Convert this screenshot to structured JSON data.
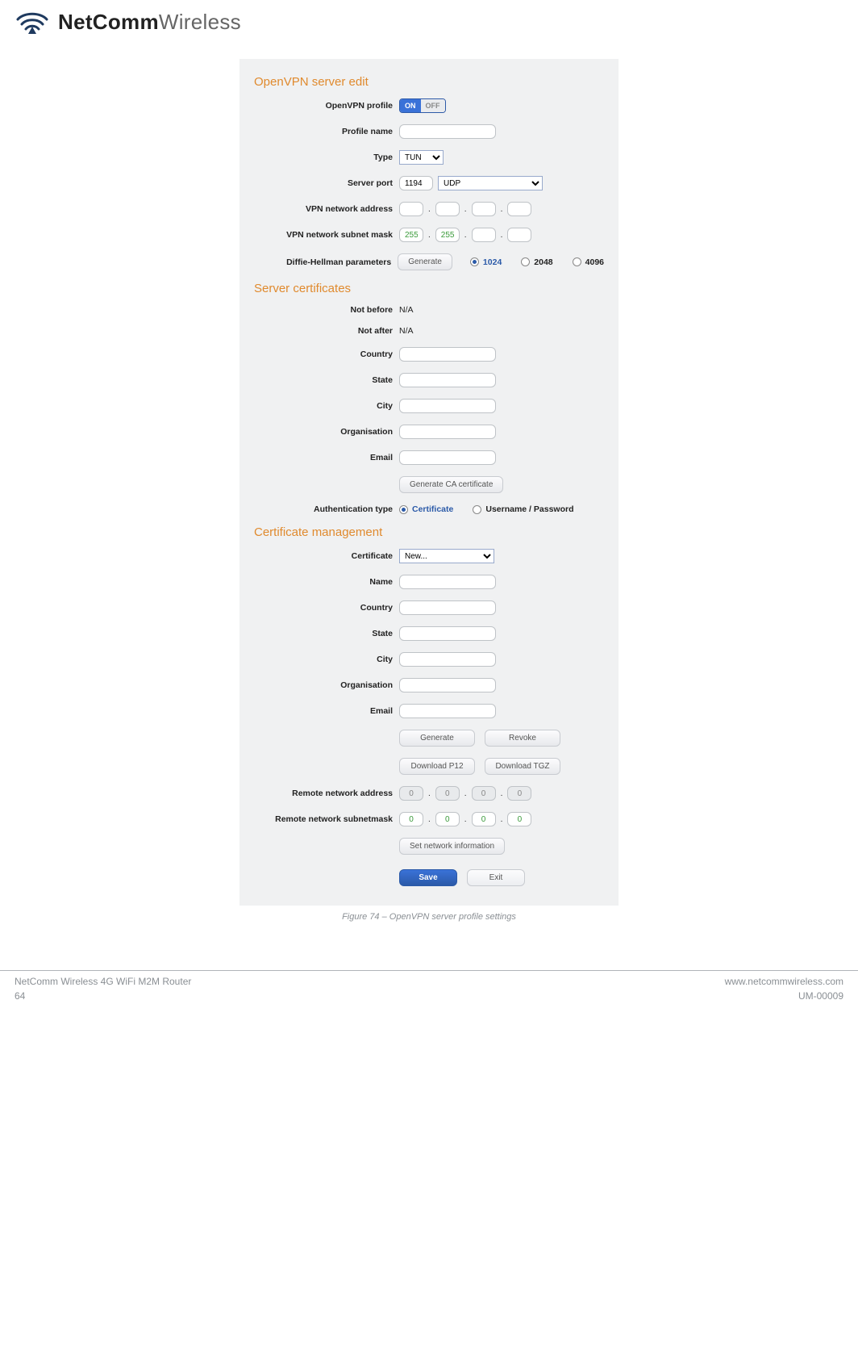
{
  "header": {
    "logo_bold": "NetComm",
    "logo_light": "Wireless"
  },
  "panel": {
    "sections": {
      "edit": {
        "title": "OpenVPN server edit",
        "profile_label": "OpenVPN profile",
        "toggle_on": "ON",
        "toggle_off": "OFF",
        "profile_name_label": "Profile name",
        "profile_name_value": "",
        "type_label": "Type",
        "type_value": "TUN",
        "server_port_label": "Server port",
        "server_port_value": "1194",
        "server_proto_value": "UDP",
        "vpn_addr_label": "VPN network address",
        "vpn_addr_oct": [
          "",
          "",
          "",
          ""
        ],
        "vpn_mask_label": "VPN network subnet mask",
        "vpn_mask_oct": [
          "255",
          "255",
          "",
          ""
        ],
        "dh_label": "Diffie-Hellman parameters",
        "generate_btn": "Generate",
        "dh_1024": "1024",
        "dh_2048": "2048",
        "dh_4096": "4096"
      },
      "certs": {
        "title": "Server certificates",
        "not_before_label": "Not before",
        "not_before_value": "N/A",
        "not_after_label": "Not after",
        "not_after_value": "N/A",
        "country_label": "Country",
        "state_label": "State",
        "city_label": "City",
        "org_label": "Organisation",
        "email_label": "Email",
        "gen_ca_btn": "Generate CA certificate",
        "auth_type_label": "Authentication type",
        "auth_cert": "Certificate",
        "auth_userpass": "Username / Password"
      },
      "mgmt": {
        "title": "Certificate management",
        "certificate_label": "Certificate",
        "certificate_value": "New...",
        "name_label": "Name",
        "country_label": "Country",
        "state_label": "State",
        "city_label": "City",
        "org_label": "Organisation",
        "email_label": "Email",
        "btn_generate": "Generate",
        "btn_revoke": "Revoke",
        "btn_dl_p12": "Download P12",
        "btn_dl_tgz": "Download TGZ",
        "remote_addr_label": "Remote network address",
        "remote_addr_oct": [
          "0",
          "0",
          "0",
          "0"
        ],
        "remote_mask_label": "Remote network subnetmask",
        "remote_mask_oct": [
          "0",
          "0",
          "0",
          "0"
        ],
        "set_net_btn": "Set network information",
        "save_btn": "Save",
        "exit_btn": "Exit"
      }
    }
  },
  "caption": "Figure 74 – OpenVPN server profile settings",
  "footer": {
    "product": "NetComm Wireless 4G WiFi M2M Router",
    "page": "64",
    "url": "www.netcommwireless.com",
    "doc": "UM-00009"
  }
}
